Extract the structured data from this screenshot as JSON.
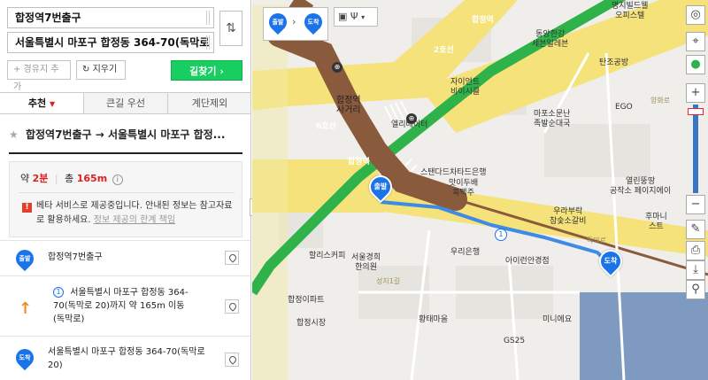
{
  "search": {
    "origin": "합정역7번출구",
    "destination": "서울특별시 마포구 합정동 364-70(독막로"
  },
  "actions": {
    "add_waypoint": "+ 경유지 추가",
    "clear": "지우기",
    "find_route": "길찾기 ›"
  },
  "tabs": [
    {
      "label": "추천",
      "active": true
    },
    {
      "label": "큰길 우선",
      "active": false
    },
    {
      "label": "계단제외",
      "active": false
    }
  ],
  "route": {
    "title": "합정역7번출구 → 서울특별시 마포구 합정...",
    "time_prefix": "약",
    "time": "2분",
    "distance_prefix": "총",
    "distance": "165m",
    "notice": "베타 서비스로 제공중입니다. 안내된 정보는 참고자료로 활용하세요.",
    "notice_link": "정보 제공의 한계 책임"
  },
  "steps": [
    {
      "badge": "출발",
      "text": "합정역7번출구"
    },
    {
      "number": "1",
      "text": "서울특별시 마포구 합정동 364-70(독막로 20)까지 약 165m 이동(독막로)"
    },
    {
      "badge": "도착",
      "text": "서울특별시 마포구 합정동 364-70(독막로 20)"
    }
  ],
  "map": {
    "mode_from": "출발",
    "mode_to": "도착",
    "start_label": "출발",
    "end_label": "도착",
    "step_marker": "1",
    "labels": {
      "hapjeong_st": "합정역",
      "line2": "2호선",
      "line6": "6호선",
      "hapjeong_intersection": "합정역\n사거리",
      "elevator": "엘리베이터",
      "standard_bank": "스탠다드차타드은행",
      "matdongbae": "맛이두배\n흑맥주",
      "xi_apt": "자이언트\n비이시클",
      "dongbang": "동양한강\n세븐일레븐",
      "myeongji": "명지빌드웰\n오피스텔",
      "tanjo": "탄조공방",
      "ego": "EGO",
      "mapo_ilgan": "마포소문난\n족발순대국",
      "yeollin": "열린뚱땅\n공작소 페이지에이",
      "uri_bank": "우리은행",
      "wooraebu": "우라부락\n참숯소갈비",
      "hollis": "할리스커피",
      "seoul_clinic": "서울경희\n한의원",
      "arirang": "아이런안경점",
      "hapjeong_apt": "합정이파트",
      "hwangtae": "황태마을",
      "mine": "미니에요",
      "hapjeong_market": "합정시장",
      "gs25": "GS25",
      "hoomanis": "후마니\n스트",
      "dongmak_ro": "독막로",
      "yanghwa_ro": "양화로",
      "seongji1": "성지1길"
    }
  }
}
